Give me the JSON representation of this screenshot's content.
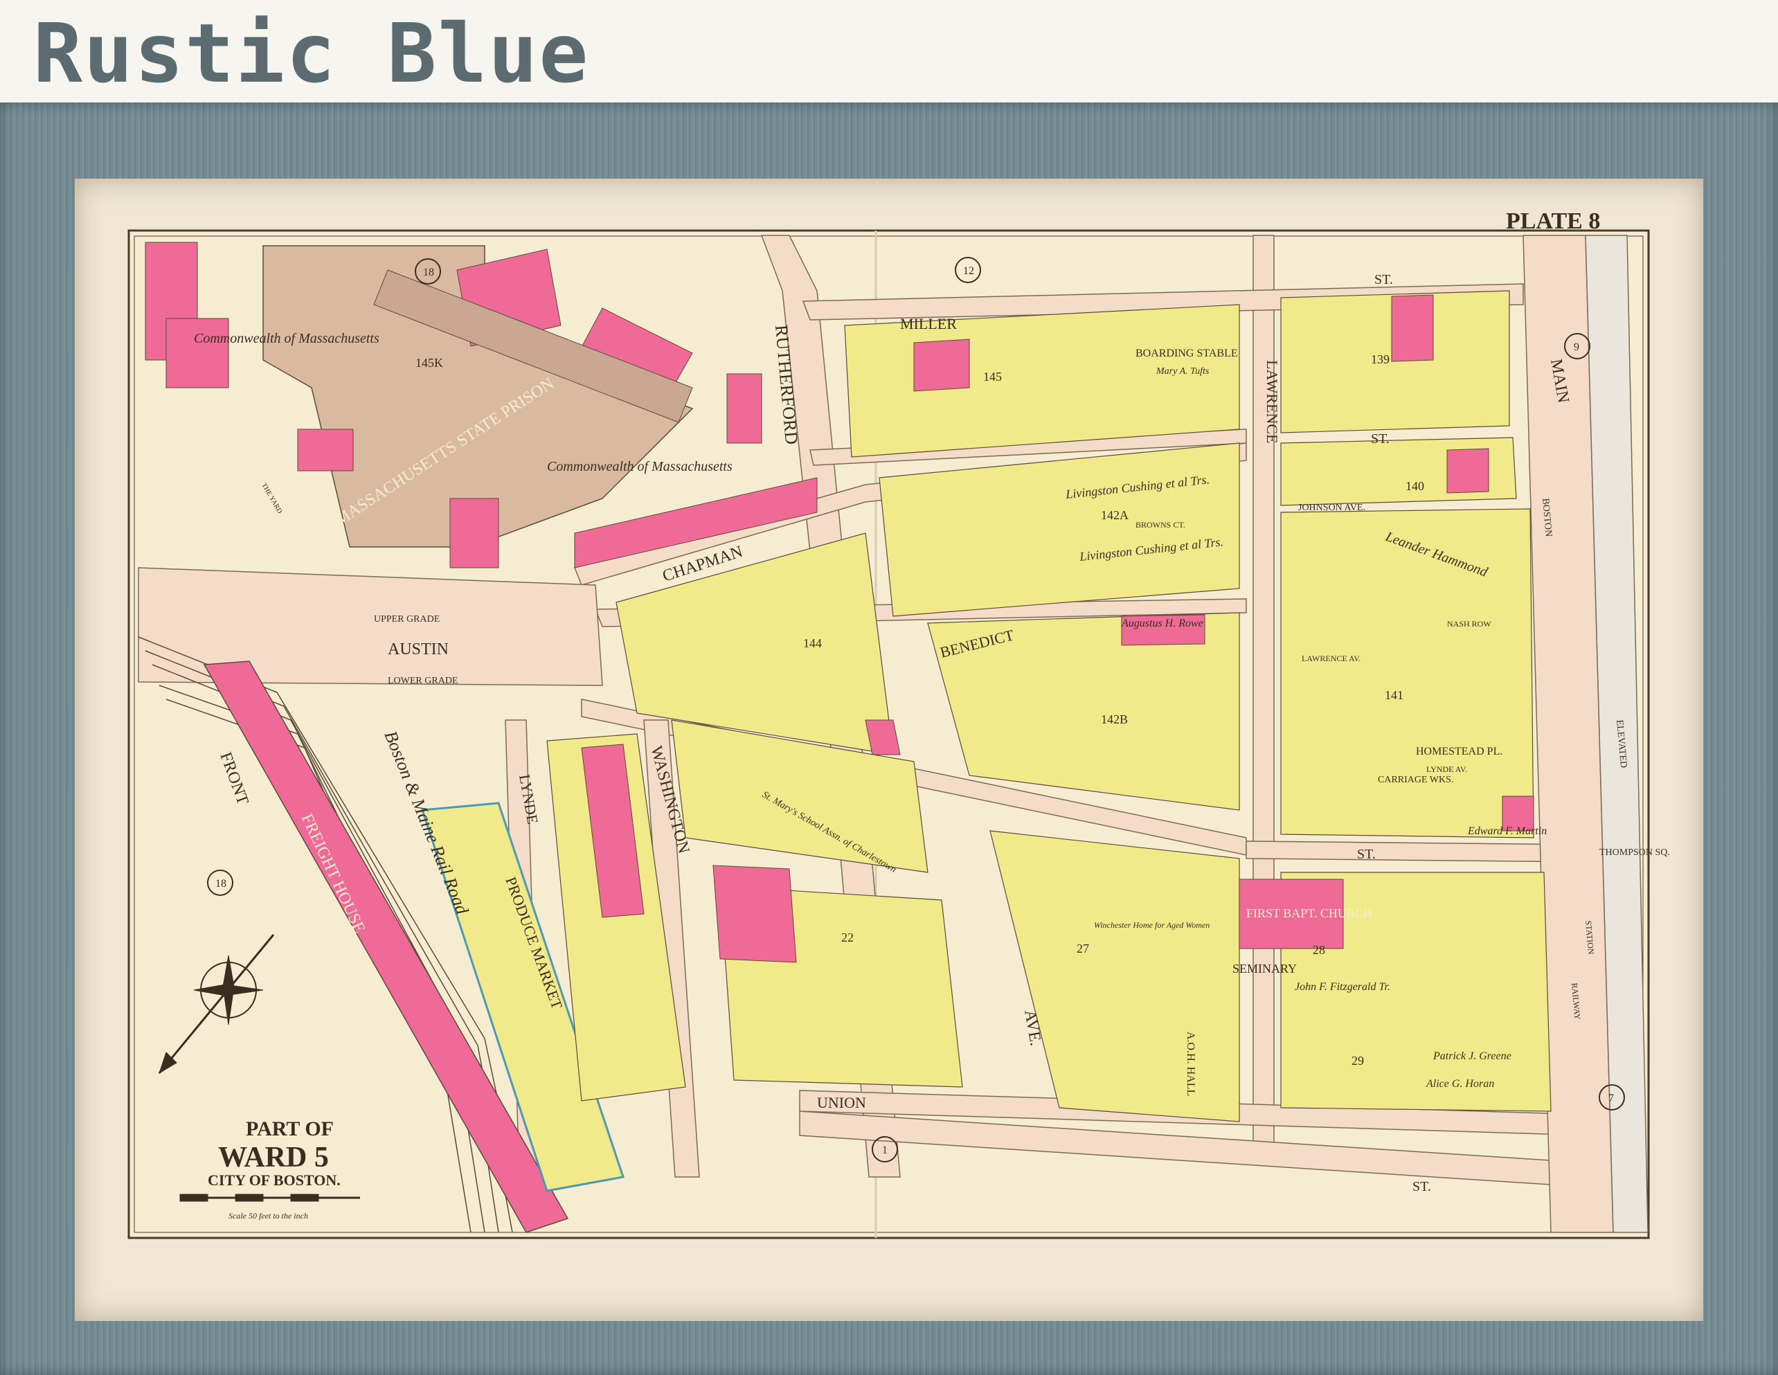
{
  "header": {
    "title": "Rustic Blue"
  },
  "map": {
    "plate": "PLATE 8",
    "title_part": "PART OF",
    "title_ward": "WARD 5",
    "title_city": "CITY OF BOSTON.",
    "scale": "Scale 50 feet to the inch",
    "streets": {
      "miller": "MILLER",
      "st_top": "ST.",
      "lawrence": "LAWRENCE",
      "main": "MAIN",
      "rutherford": "RUTHERFORD",
      "chapman": "CHAPMAN",
      "benedict": "BENEDICT",
      "austin": "AUSTIN",
      "upper_grade": "UPPER GRADE",
      "lower_grade": "LOWER GRADE",
      "front": "FRONT",
      "washington": "WASHINGTON",
      "lynde": "LYNDE",
      "union": "UNION",
      "ave": "AVE.",
      "st_bottom": "ST.",
      "st_vertical": "ST.",
      "seminary": "SEMINARY",
      "johnson_ave": "JOHNSON AVE.",
      "homestead": "HOMESTEAD PL.",
      "thompson_sq": "THOMPSON SQ.",
      "elevated": "ELEVATED",
      "boston": "BOSTON",
      "browns_ct": "BROWNS CT.",
      "nash_row": "NASH ROW",
      "lynde_av": "LYNDE AV.",
      "lawrence_av": "LAWRENCE AV.",
      "railway": "RAILWAY",
      "station": "STATION"
    },
    "places": {
      "prison": "MASSACHUSETTS STATE PRISON",
      "commonwealth_1": "Commonwealth of Massachusetts",
      "commonwealth_2": "Commonwealth of Massachusetts",
      "freight_house": "FREIGHT HOUSE",
      "produce_market": "PRODUCE MARKET",
      "boston_maine": "Boston & Maine Rail Road",
      "boarding_stable": "BOARDING STABLE",
      "first_bapt": "FIRST BAPT. CHURCH",
      "school": "St. Mary's School Assn. of Charlestown",
      "livingston_1": "Livingston Cushing et al Trs.",
      "livingston_2": "Livingston Cushing et al Trs.",
      "leander": "Leander Hammond",
      "carriage": "CARRIAGE WKS.",
      "winchester": "Winchester Home for Aged Women",
      "a_o_h_hall": "A.O.H. HALL",
      "mary_tufts": "Mary A. Tufts",
      "augustus": "Augustus H. Rowe",
      "patrick": "Patrick J. Greene",
      "alice": "Alice G. Horan",
      "john_fitzgerald": "John F. Fitzgerald Tr.",
      "edward_martin": "Edward F. Martin",
      "the_yard": "THE YARD"
    },
    "block_numbers": [
      "145K",
      "145",
      "139",
      "140",
      "142A",
      "142B",
      "144",
      "141",
      "22",
      "27",
      "28",
      "29"
    ],
    "ward_circles": [
      "18",
      "12",
      "9",
      "18",
      "1",
      "7"
    ]
  },
  "colors": {
    "frame": "#6f8790",
    "paper": "#f6ecd2",
    "pink": "#f06a97",
    "yellow": "#f2ea8a",
    "street": "#f4dcc9",
    "ink": "#4a3a2c"
  }
}
